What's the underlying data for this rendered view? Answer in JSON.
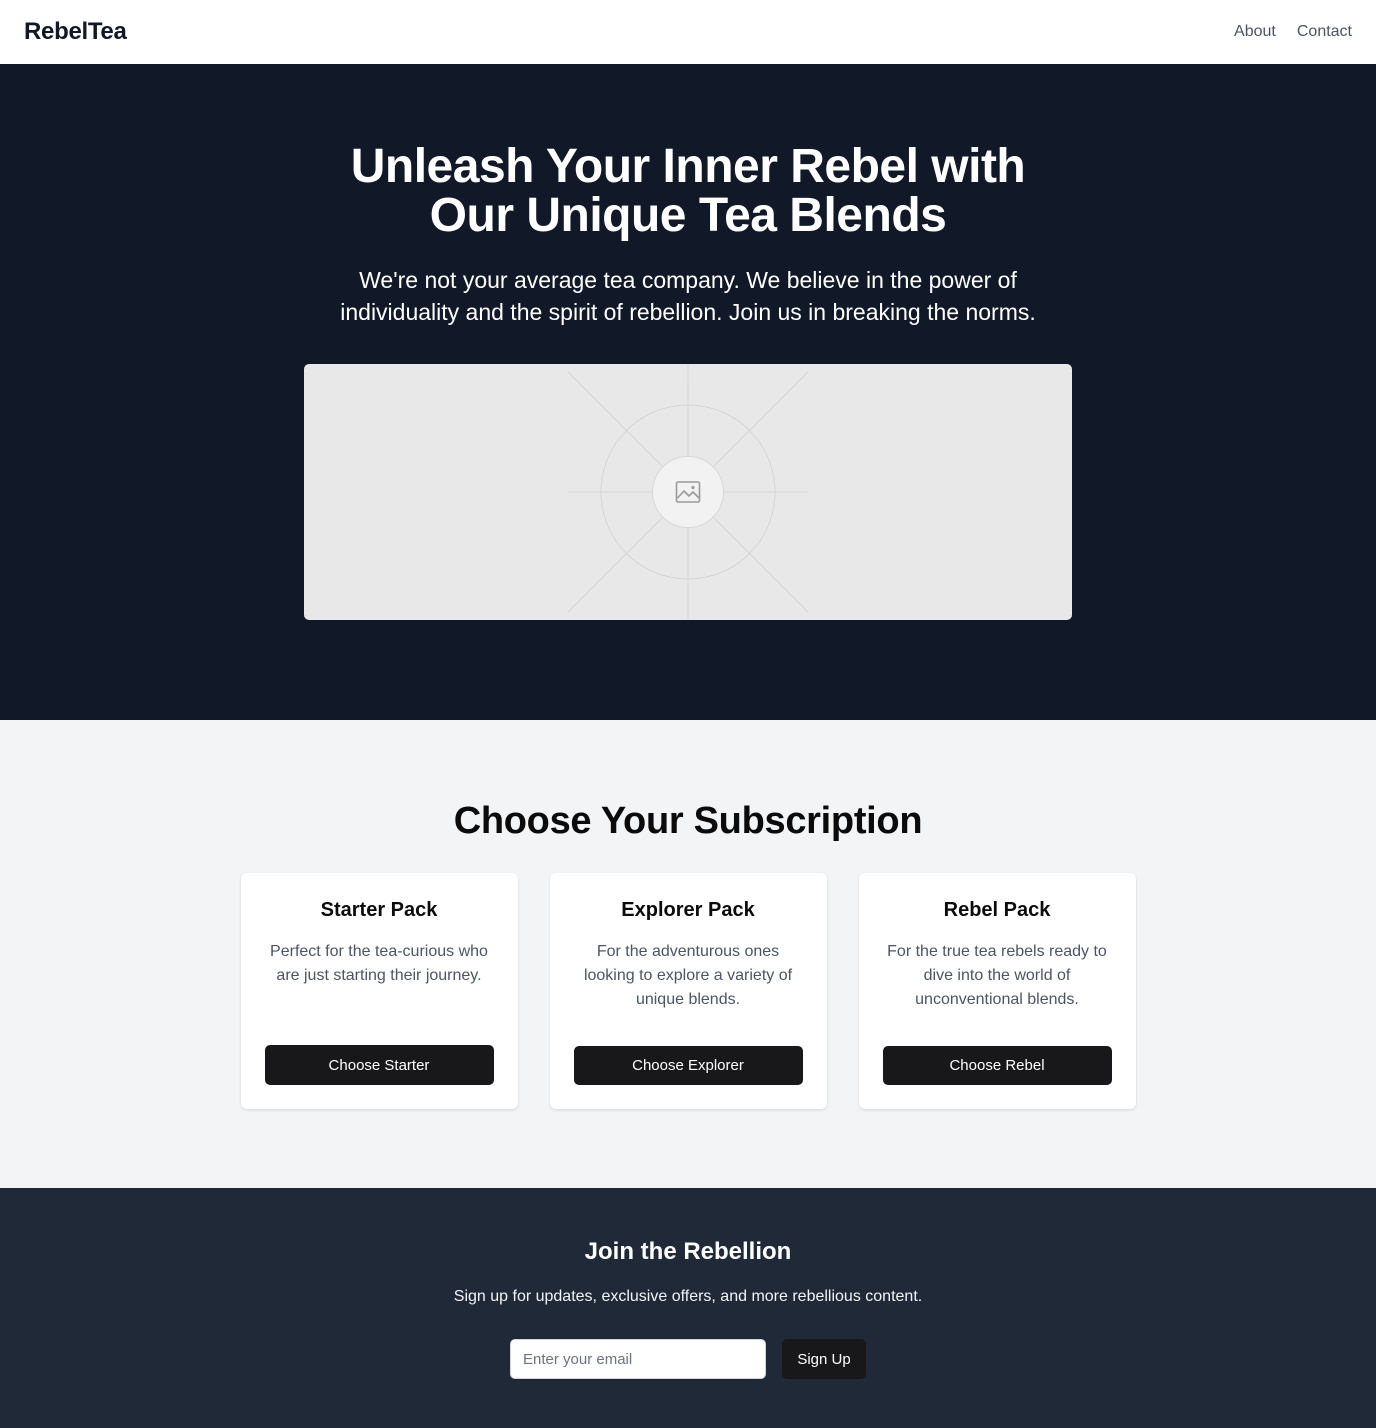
{
  "header": {
    "brand": "RebelTea",
    "nav": [
      "About",
      "Contact"
    ]
  },
  "hero": {
    "title": "Unleash Your Inner Rebel with Our Unique Tea Blends",
    "subtitle": "We're not your average tea company. We believe in the power of individuality and the spirit of rebellion. Join us in breaking the norms.",
    "image_icon": "image-placeholder-icon"
  },
  "subscriptions": {
    "title": "Choose Your Subscription",
    "plans": [
      {
        "name": "Starter Pack",
        "description": "Perfect for the tea-curious who are just starting their journey.",
        "button": "Choose Starter"
      },
      {
        "name": "Explorer Pack",
        "description": "For the adventurous ones looking to explore a variety of unique blends.",
        "button": "Choose Explorer"
      },
      {
        "name": "Rebel Pack",
        "description": "For the true tea rebels ready to dive into the world of unconventional blends.",
        "button": "Choose Rebel"
      }
    ]
  },
  "join": {
    "title": "Join the Rebellion",
    "text": "Sign up for updates, exclusive offers, and more rebellious content.",
    "email_placeholder": "Enter your email",
    "button": "Sign Up"
  },
  "colors": {
    "hero_bg": "#111827",
    "section_bg": "#f3f4f6",
    "footer_bg": "#1f2937",
    "button_bg": "#18181b"
  }
}
